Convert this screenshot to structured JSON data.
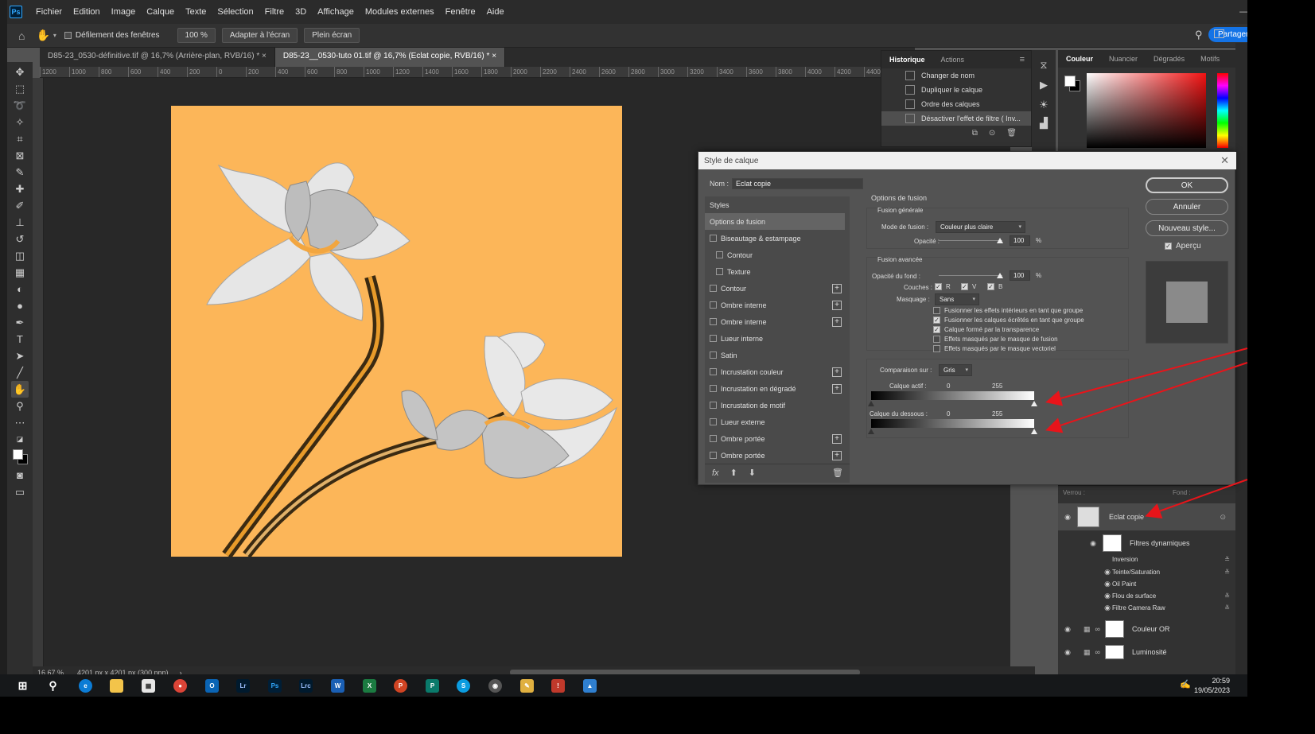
{
  "menu": [
    "Fichier",
    "Edition",
    "Image",
    "Calque",
    "Texte",
    "Sélection",
    "Filtre",
    "3D",
    "Affichage",
    "Modules externes",
    "Fenêtre",
    "Aide"
  ],
  "options": {
    "scroll_all": "Défilement des fenêtres",
    "zoom": "100 %",
    "fit": "Adapter à l'écran",
    "full": "Plein écran",
    "share": "Partager"
  },
  "tabs": [
    "D85-23_0530-définitive.tif @ 16,7% (Arrière-plan, RVB/16) *",
    "D85-23__0530-tuto 01.tif @ 16,7% (Eclat copie, RVB/16) *"
  ],
  "ruler": [
    "1200",
    "1000",
    "800",
    "600",
    "400",
    "200",
    "0",
    "200",
    "400",
    "600",
    "800",
    "1000",
    "1200",
    "1400",
    "1600",
    "1800",
    "2000",
    "2200",
    "2400",
    "2600",
    "2800",
    "3000",
    "3200",
    "3400",
    "3600",
    "3800",
    "4000",
    "4200",
    "4400",
    "4600",
    "4800",
    "5000",
    "5200",
    "5400",
    "5600",
    "5800",
    "6000",
    "6200",
    "6400"
  ],
  "status": {
    "zoom": "16,67 %",
    "size": "4201 px x 4201 px (300 ppp)"
  },
  "history": {
    "tabs": [
      "Historique",
      "Actions"
    ],
    "items": [
      "Changer de nom",
      "Dupliquer le calque",
      "Ordre des calques",
      "Désactiver l'effet de filtre ( Inv..."
    ]
  },
  "color_panel": {
    "tabs": [
      "Couleur",
      "Nuancier",
      "Dégradés",
      "Motifs"
    ],
    "accent": "#f21212"
  },
  "dialog": {
    "title": "Style de calque",
    "name_label": "Nom :",
    "name_value": "Eclat copie",
    "styles_header": "Styles",
    "styles": [
      {
        "label": "Options de fusion",
        "sub": false,
        "check": false,
        "plus": false,
        "selected": true
      },
      {
        "label": "Biseautage & estampage",
        "sub": false,
        "check": true,
        "plus": false
      },
      {
        "label": "Contour",
        "sub": true,
        "check": true,
        "plus": false
      },
      {
        "label": "Texture",
        "sub": true,
        "check": true,
        "plus": false
      },
      {
        "label": "Contour",
        "sub": false,
        "check": true,
        "plus": true
      },
      {
        "label": "Ombre interne",
        "sub": false,
        "check": true,
        "plus": true
      },
      {
        "label": "Ombre interne",
        "sub": false,
        "check": true,
        "plus": true
      },
      {
        "label": "Lueur interne",
        "sub": false,
        "check": true,
        "plus": false
      },
      {
        "label": "Satin",
        "sub": false,
        "check": true,
        "plus": false
      },
      {
        "label": "Incrustation couleur",
        "sub": false,
        "check": true,
        "plus": true
      },
      {
        "label": "Incrustation en dégradé",
        "sub": false,
        "check": true,
        "plus": true
      },
      {
        "label": "Incrustation de motif",
        "sub": false,
        "check": true,
        "plus": false
      },
      {
        "label": "Lueur externe",
        "sub": false,
        "check": true,
        "plus": false
      },
      {
        "label": "Ombre portée",
        "sub": false,
        "check": true,
        "plus": true
      },
      {
        "label": "Ombre portée",
        "sub": false,
        "check": true,
        "plus": true
      }
    ],
    "blend": {
      "section": "Options de fusion",
      "general": "Fusion générale",
      "mode_label": "Mode de fusion :",
      "mode_value": "Couleur plus claire",
      "opacity_label": "Opacité :",
      "opacity_value": "100",
      "pct": "%",
      "advanced": "Fusion avancée",
      "fill_label": "Opacité du fond :",
      "fill_value": "100",
      "channels_label": "Couches :",
      "ch_r": "R",
      "ch_v": "V",
      "ch_b": "B",
      "knockout_label": "Masquage :",
      "knockout_value": "Sans",
      "checks": [
        {
          "label": "Fusionner les effets intérieurs en tant que groupe",
          "on": false
        },
        {
          "label": "Fusionner les calques écrêtés en tant que groupe",
          "on": true
        },
        {
          "label": "Calque formé par la transparence",
          "on": true
        },
        {
          "label": "Effets masqués par le masque de fusion",
          "on": false
        },
        {
          "label": "Effets masqués par le masque vectoriel",
          "on": false
        }
      ],
      "blendif_label": "Comparaison sur :",
      "blendif_value": "Gris",
      "this_layer": "Calque actif :",
      "underlying": "Calque du dessous :",
      "min": "0",
      "max": "255"
    },
    "ok": "OK",
    "cancel": "Annuler",
    "new_style": "Nouveau style...",
    "preview": "Aperçu"
  },
  "layers": {
    "lock": "Verrou :",
    "fill": "Fond :",
    "items": [
      "Eclat copie",
      "Filtres dynamiques",
      "Couleur OR",
      "Luminosité"
    ],
    "filters": [
      "Inversion",
      "Teinte/Saturation",
      "Oil Paint",
      "Flou de surface",
      "Filtre Camera Raw"
    ]
  },
  "taskbar": {
    "apps": [
      "Lr",
      "Ps",
      "Lrc",
      "W",
      "X",
      "P",
      "P",
      "S"
    ],
    "time": "20:59",
    "date": "19/05/2023"
  },
  "annotation_color": "#e8141a"
}
